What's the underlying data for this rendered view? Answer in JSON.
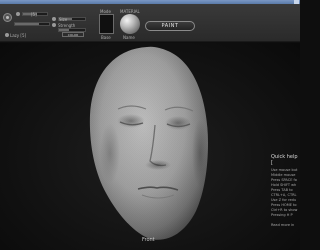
{
  "toolbar": {
    "brush_size": {
      "label": "Draw Size",
      "value_label": "[5]"
    },
    "intensity": {
      "label": "Size"
    },
    "opacity": {
      "label": "Strength"
    },
    "lazy": {
      "label": "Lazy [5]"
    },
    "sub_button": "COLOR",
    "swatch_label": "Base",
    "material_title": "MATERIAL",
    "material_label": "Name",
    "shading_title": "Mode",
    "paint_button": "PAINT"
  },
  "quick_help": {
    "title": "Quick help [",
    "lines": [
      "Use mouse but",
      "Middle mouse",
      "Press SPACE fo",
      "Hold SHIFT wh",
      "Press TAB to",
      "CTRL+A, CTRL",
      "Use Z for redu",
      "Press HOME to",
      "Ctrl+R to show",
      "Pressing H P",
      "Read more in"
    ]
  },
  "viewport": {
    "view_label": "Front"
  },
  "colors": {
    "accent_title_bar": "#6d8bb8",
    "background": "#141414",
    "mesh": "#a9a9a9"
  }
}
